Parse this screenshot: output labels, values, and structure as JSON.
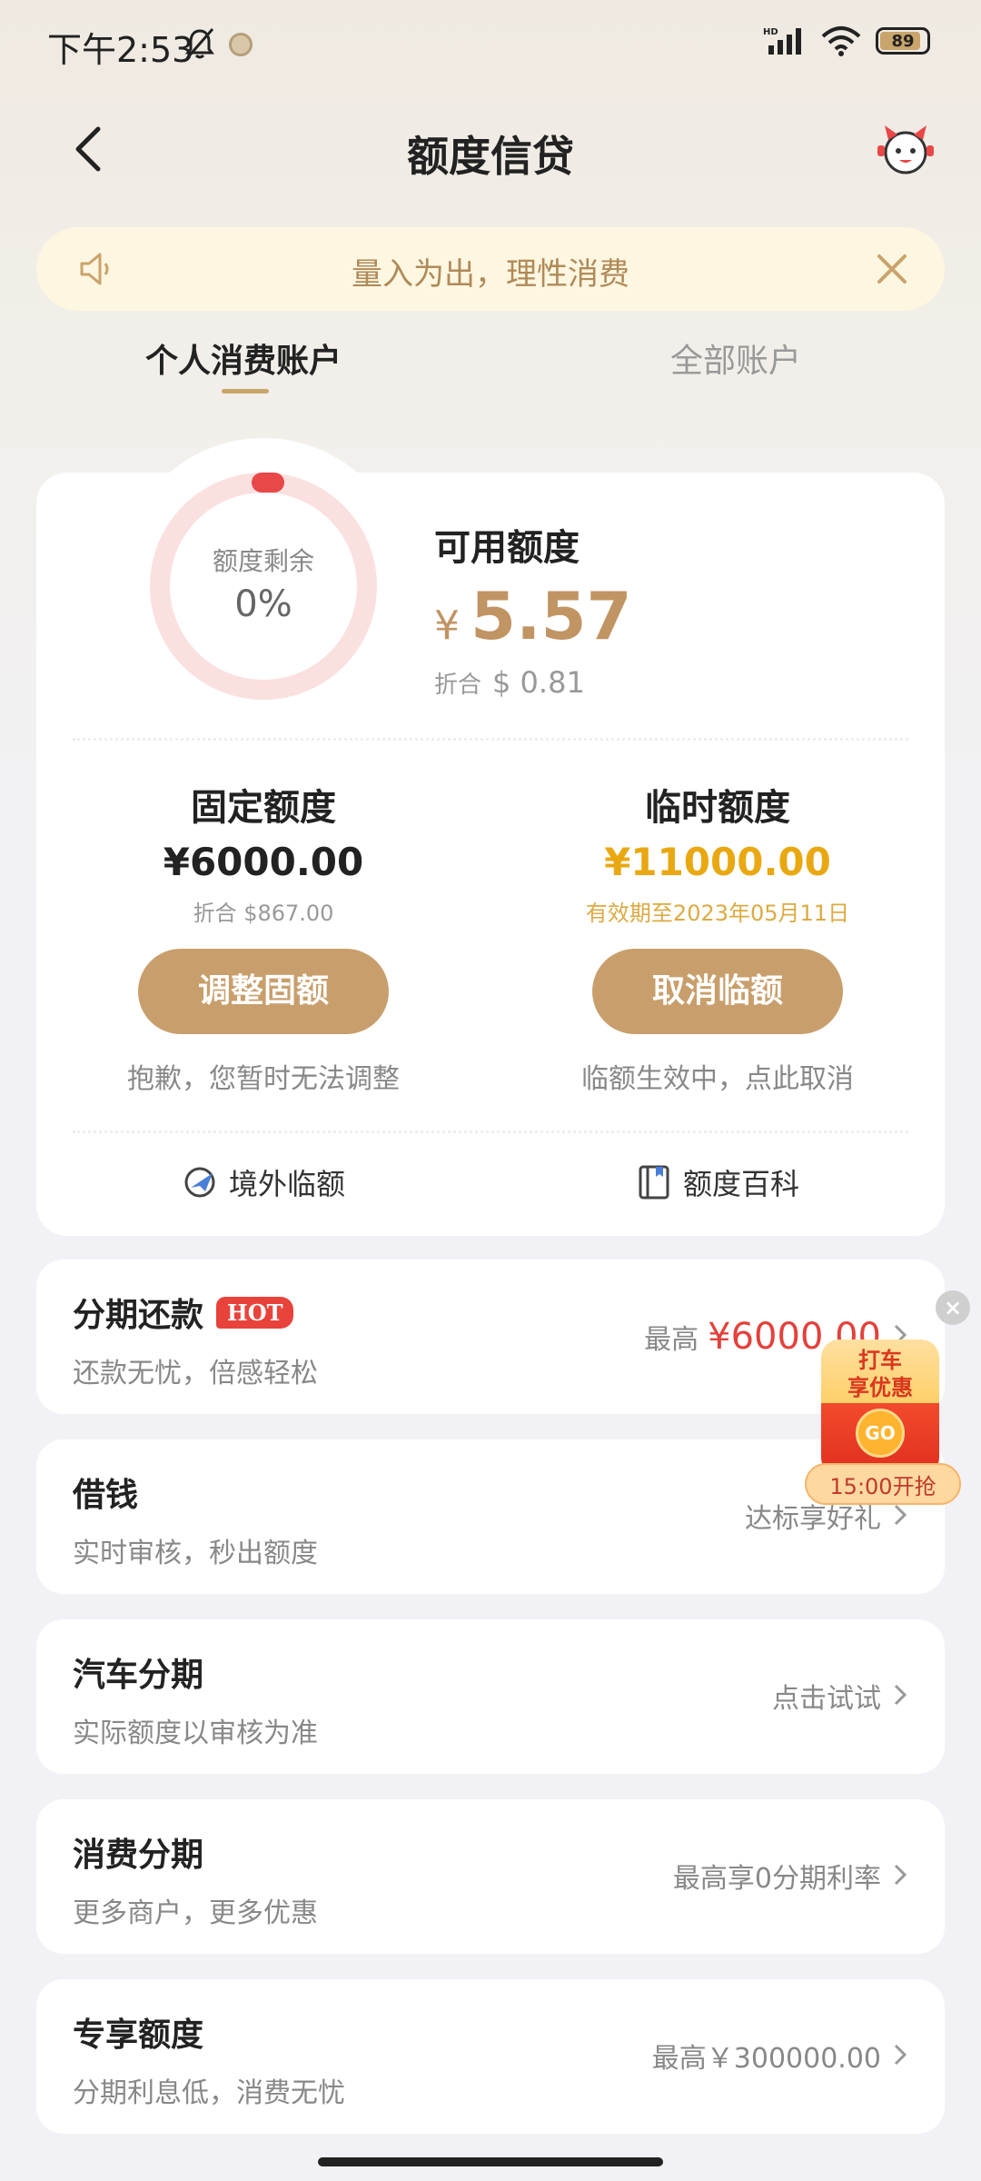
{
  "status_bar": {
    "time": "下午2:53",
    "network": "HD",
    "battery": "89"
  },
  "header": {
    "title": "额度信贷"
  },
  "notice": {
    "text": "量入为出，理性消费"
  },
  "tabs": [
    {
      "label": "个人消费账户",
      "active": true
    },
    {
      "label": "全部账户",
      "active": false
    }
  ],
  "credit": {
    "remaining_label": "额度剩余",
    "remaining_pct": "0%",
    "available_label": "可用额度",
    "currency_symbol": "¥",
    "available_amount": "5.57",
    "converted_label": "折合",
    "converted_value": "$ 0.81",
    "fixed": {
      "title": "固定额度",
      "amount": "¥6000.00",
      "sub": "折合 $867.00",
      "button": "调整固额",
      "hint": "抱歉，您暂时无法调整"
    },
    "temporary": {
      "title": "临时额度",
      "amount": "¥11000.00",
      "sub": "有效期至2023年05月11日",
      "button": "取消临额",
      "hint": "临额生效中，点此取消"
    },
    "links": {
      "overseas": "境外临额",
      "wiki": "额度百科"
    }
  },
  "items": [
    {
      "title": "分期还款",
      "badge": "HOT",
      "sub": "还款无忧，倍感轻松",
      "right_prefix": "最高",
      "right_value": "¥6000.00"
    },
    {
      "title": "借钱",
      "sub": "实时审核，秒出额度",
      "right": "达标享好礼"
    },
    {
      "title": "汽车分期",
      "sub": "实际额度以审核为准",
      "right": "点击试试"
    },
    {
      "title": "消费分期",
      "sub": "更多商户，更多优惠",
      "right": "最高享0分期利率"
    },
    {
      "title": "专享额度",
      "sub": "分期利息低，消费无忧",
      "right": "最高￥300000.00"
    }
  ],
  "promo": {
    "label_line1": "打车",
    "label_line2": "享优惠",
    "go": "GO",
    "time": "15:00开抢"
  },
  "colors": {
    "gold": "#c89f6c",
    "temp_amount": "#e9a812",
    "hot_red": "#e8433b"
  }
}
